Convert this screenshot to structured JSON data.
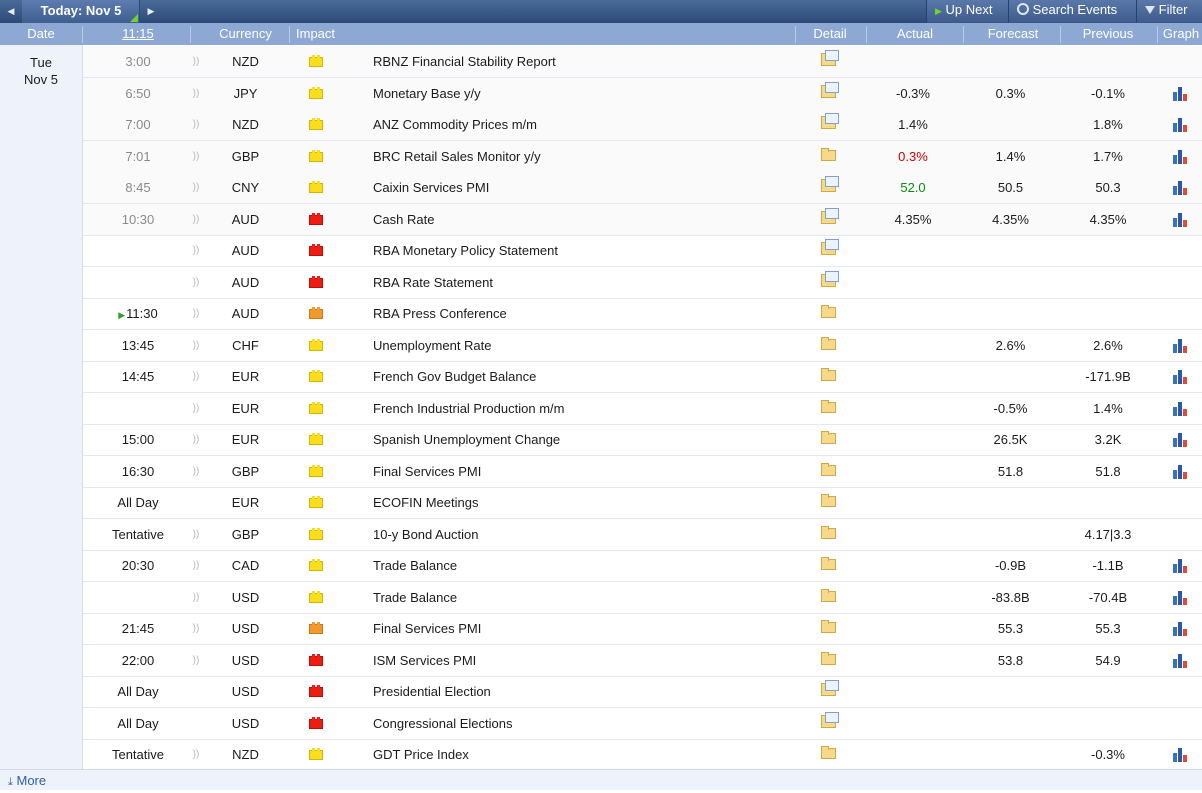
{
  "toolbar": {
    "today_label": "Today: Nov 5",
    "up_next_label": "Up Next",
    "search_label": "Search Events",
    "filter_label": "Filter"
  },
  "columns": {
    "date": "Date",
    "time": "11:15",
    "currency": "Currency",
    "impact": "Impact",
    "detail": "Detail",
    "actual": "Actual",
    "forecast": "Forecast",
    "previous": "Previous",
    "graph": "Graph"
  },
  "date_group": {
    "weekday": "Tue",
    "date": "Nov 5"
  },
  "colors": {
    "impact_low": "#fadd1c",
    "impact_medium": "#f29a2e",
    "impact_high": "#ef1c12",
    "better": "#0f8a0f",
    "worse": "#cc0000"
  },
  "events": [
    {
      "time": "3:00",
      "past": true,
      "currency": "NZD",
      "impact": "low",
      "event": "RBNZ Financial Stability Report",
      "detail": "doc",
      "actual": "",
      "actual_tone": "",
      "forecast": "",
      "previous": "",
      "graph": false
    },
    {
      "time": "6:50",
      "past": true,
      "currency": "JPY",
      "impact": "low",
      "event": "Monetary Base y/y",
      "detail": "doc",
      "actual": "-0.3%",
      "actual_tone": "",
      "forecast": "0.3%",
      "previous": "-0.1%",
      "graph": true
    },
    {
      "time": "7:00",
      "past": true,
      "currency": "NZD",
      "impact": "low",
      "event": "ANZ Commodity Prices m/m",
      "detail": "doc",
      "actual": "1.4%",
      "actual_tone": "",
      "forecast": "",
      "previous": "1.8%",
      "graph": true
    },
    {
      "time": "7:01",
      "past": true,
      "currency": "GBP",
      "impact": "low",
      "event": "BRC Retail Sales Monitor y/y",
      "detail": "folder",
      "actual": "0.3%",
      "actual_tone": "worse",
      "forecast": "1.4%",
      "previous": "1.7%",
      "graph": true
    },
    {
      "time": "8:45",
      "past": true,
      "currency": "CNY",
      "impact": "low",
      "event": "Caixin Services PMI",
      "detail": "doc",
      "actual": "52.0",
      "actual_tone": "better",
      "forecast": "50.5",
      "previous": "50.3",
      "graph": true
    },
    {
      "time": "10:30",
      "past": true,
      "currency": "AUD",
      "impact": "high",
      "event": "Cash Rate",
      "detail": "doc",
      "actual": "4.35%",
      "actual_tone": "",
      "forecast": "4.35%",
      "previous": "4.35%",
      "graph": true
    },
    {
      "time": "",
      "past": false,
      "currency": "AUD",
      "impact": "high",
      "event": "RBA Monetary Policy Statement",
      "detail": "doc",
      "actual": "",
      "actual_tone": "",
      "forecast": "",
      "previous": "",
      "graph": false
    },
    {
      "time": "",
      "past": false,
      "currency": "AUD",
      "impact": "high",
      "event": "RBA Rate Statement",
      "detail": "doc",
      "actual": "",
      "actual_tone": "",
      "forecast": "",
      "previous": "",
      "graph": false
    },
    {
      "time": "11:30",
      "past": false,
      "live": true,
      "currency": "AUD",
      "impact": "med",
      "event": "RBA Press Conference",
      "detail": "folder",
      "actual": "",
      "actual_tone": "",
      "forecast": "",
      "previous": "",
      "graph": false
    },
    {
      "time": "13:45",
      "past": false,
      "currency": "CHF",
      "impact": "low",
      "event": "Unemployment Rate",
      "detail": "folder",
      "actual": "",
      "actual_tone": "",
      "forecast": "2.6%",
      "previous": "2.6%",
      "graph": true
    },
    {
      "time": "14:45",
      "past": false,
      "currency": "EUR",
      "impact": "low",
      "event": "French Gov Budget Balance",
      "detail": "folder",
      "actual": "",
      "actual_tone": "",
      "forecast": "",
      "previous": "-171.9B",
      "graph": true
    },
    {
      "time": "",
      "past": false,
      "currency": "EUR",
      "impact": "low",
      "event": "French Industrial Production m/m",
      "detail": "folder",
      "actual": "",
      "actual_tone": "",
      "forecast": "-0.5%",
      "previous": "1.4%",
      "graph": true
    },
    {
      "time": "15:00",
      "past": false,
      "currency": "EUR",
      "impact": "low",
      "event": "Spanish Unemployment Change",
      "detail": "folder",
      "actual": "",
      "actual_tone": "",
      "forecast": "26.5K",
      "previous": "3.2K",
      "graph": true
    },
    {
      "time": "16:30",
      "past": false,
      "currency": "GBP",
      "impact": "low",
      "event": "Final Services PMI",
      "detail": "folder",
      "actual": "",
      "actual_tone": "",
      "forecast": "51.8",
      "previous": "51.8",
      "graph": true
    },
    {
      "time": "All Day",
      "past": false,
      "nospk": true,
      "currency": "EUR",
      "impact": "low",
      "event": "ECOFIN Meetings",
      "detail": "folder",
      "actual": "",
      "actual_tone": "",
      "forecast": "",
      "previous": "",
      "graph": false
    },
    {
      "time": "Tentative",
      "past": false,
      "currency": "GBP",
      "impact": "low",
      "event": "10-y Bond Auction",
      "detail": "folder",
      "actual": "",
      "actual_tone": "",
      "forecast": "",
      "previous": "4.17|3.3",
      "graph": false
    },
    {
      "time": "20:30",
      "past": false,
      "currency": "CAD",
      "impact": "low",
      "event": "Trade Balance",
      "detail": "folder",
      "actual": "",
      "actual_tone": "",
      "forecast": "-0.9B",
      "previous": "-1.1B",
      "graph": true
    },
    {
      "time": "",
      "past": false,
      "currency": "USD",
      "impact": "low",
      "event": "Trade Balance",
      "detail": "folder",
      "actual": "",
      "actual_tone": "",
      "forecast": "-83.8B",
      "previous": "-70.4B",
      "graph": true
    },
    {
      "time": "21:45",
      "past": false,
      "currency": "USD",
      "impact": "med",
      "event": "Final Services PMI",
      "detail": "folder",
      "actual": "",
      "actual_tone": "",
      "forecast": "55.3",
      "previous": "55.3",
      "graph": true
    },
    {
      "time": "22:00",
      "past": false,
      "currency": "USD",
      "impact": "high",
      "event": "ISM Services PMI",
      "detail": "folder",
      "actual": "",
      "actual_tone": "",
      "forecast": "53.8",
      "previous": "54.9",
      "graph": true
    },
    {
      "time": "All Day",
      "past": false,
      "nospk": true,
      "currency": "USD",
      "impact": "high",
      "event": "Presidential Election",
      "detail": "doc",
      "actual": "",
      "actual_tone": "",
      "forecast": "",
      "previous": "",
      "graph": false
    },
    {
      "time": "All Day",
      "past": false,
      "nospk": true,
      "currency": "USD",
      "impact": "high",
      "event": "Congressional Elections",
      "detail": "doc",
      "actual": "",
      "actual_tone": "",
      "forecast": "",
      "previous": "",
      "graph": false
    },
    {
      "time": "Tentative",
      "past": false,
      "currency": "NZD",
      "impact": "low",
      "event": "GDT Price Index",
      "detail": "folder",
      "actual": "",
      "actual_tone": "",
      "forecast": "",
      "previous": "-0.3%",
      "graph": true
    }
  ],
  "footer": {
    "more_label": "More"
  }
}
